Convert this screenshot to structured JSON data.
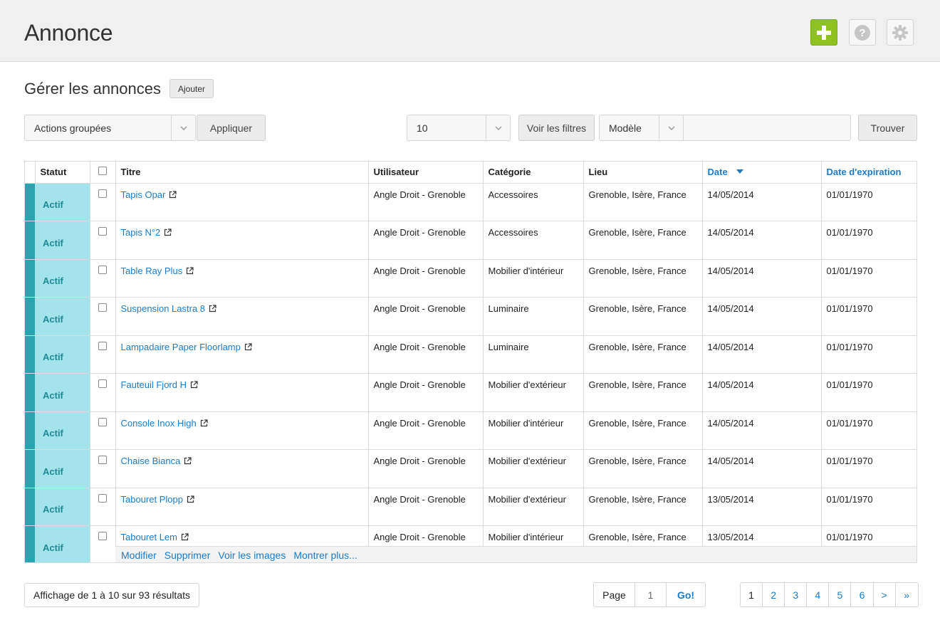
{
  "header": {
    "title": "Annonce",
    "add_icon": "plus-icon",
    "help_icon": "help-icon",
    "settings_icon": "gear-icon"
  },
  "section": {
    "title": "Gérer les annonces",
    "add_label": "Ajouter"
  },
  "toolbar": {
    "bulk_actions": "Actions groupées",
    "apply_label": "Appliquer",
    "per_page": "10",
    "filters_label": "Voir les filtres",
    "model_select": "Modèle",
    "search_value": "",
    "find_label": "Trouver"
  },
  "table": {
    "columns": [
      "Statut",
      "Titre",
      "Utilisateur",
      "Catégorie",
      "Lieu",
      "Date",
      "Date d'expiration"
    ],
    "rows": [
      {
        "status": "Actif",
        "title": "Tapis Opar",
        "user": "Angle Droit - Grenoble",
        "category": "Accessoires",
        "location": "Grenoble, Isère, France",
        "date": "14/05/2014",
        "expiration": "01/01/1970"
      },
      {
        "status": "Actif",
        "title": "Tapis N°2",
        "user": "Angle Droit - Grenoble",
        "category": "Accessoires",
        "location": "Grenoble, Isère, France",
        "date": "14/05/2014",
        "expiration": "01/01/1970"
      },
      {
        "status": "Actif",
        "title": "Table Ray Plus",
        "user": "Angle Droit - Grenoble",
        "category": "Mobilier d'intérieur",
        "location": "Grenoble, Isère, France",
        "date": "14/05/2014",
        "expiration": "01/01/1970"
      },
      {
        "status": "Actif",
        "title": "Suspension Lastra 8",
        "user": "Angle Droit - Grenoble",
        "category": "Luminaire",
        "location": "Grenoble, Isère, France",
        "date": "14/05/2014",
        "expiration": "01/01/1970"
      },
      {
        "status": "Actif",
        "title": "Lampadaire Paper Floorlamp",
        "user": "Angle Droit - Grenoble",
        "category": "Luminaire",
        "location": "Grenoble, Isère, France",
        "date": "14/05/2014",
        "expiration": "01/01/1970"
      },
      {
        "status": "Actif",
        "title": "Fauteuil Fjord H",
        "user": "Angle Droit - Grenoble",
        "category": "Mobilier d'extérieur",
        "location": "Grenoble, Isère, France",
        "date": "14/05/2014",
        "expiration": "01/01/1970"
      },
      {
        "status": "Actif",
        "title": "Console Inox High",
        "user": "Angle Droit - Grenoble",
        "category": "Mobilier d'intérieur",
        "location": "Grenoble, Isère, France",
        "date": "14/05/2014",
        "expiration": "01/01/1970"
      },
      {
        "status": "Actif",
        "title": "Chaise Bianca",
        "user": "Angle Droit - Grenoble",
        "category": "Mobilier d'extérieur",
        "location": "Grenoble, Isère, France",
        "date": "14/05/2014",
        "expiration": "01/01/1970"
      },
      {
        "status": "Actif",
        "title": "Tabouret Plopp",
        "user": "Angle Droit - Grenoble",
        "category": "Mobilier d'extérieur",
        "location": "Grenoble, Isère, France",
        "date": "13/05/2014",
        "expiration": "01/01/1970"
      },
      {
        "status": "Actif",
        "title": "Tabouret Lem",
        "user": "Angle Droit - Grenoble",
        "category": "Mobilier d'intérieur",
        "location": "Grenoble, Isère, France",
        "date": "13/05/2014",
        "expiration": "01/01/1970"
      }
    ],
    "row_actions": [
      "Modifier",
      "Supprimer",
      "Voir les images",
      "Montrer plus..."
    ]
  },
  "footer": {
    "results": "Affichage de 1 à 10 sur 93 résultats",
    "page_label": "Page",
    "page_value": "1",
    "go_label": "Go!",
    "pages": [
      "1",
      "2",
      "3",
      "4",
      "5",
      "6",
      ">",
      "»"
    ]
  },
  "colors": {
    "accent": "#8dc21f",
    "link": "#1a7bc9",
    "status_bg": "#a3e3ec",
    "status_stripe": "#2aa5b0"
  }
}
